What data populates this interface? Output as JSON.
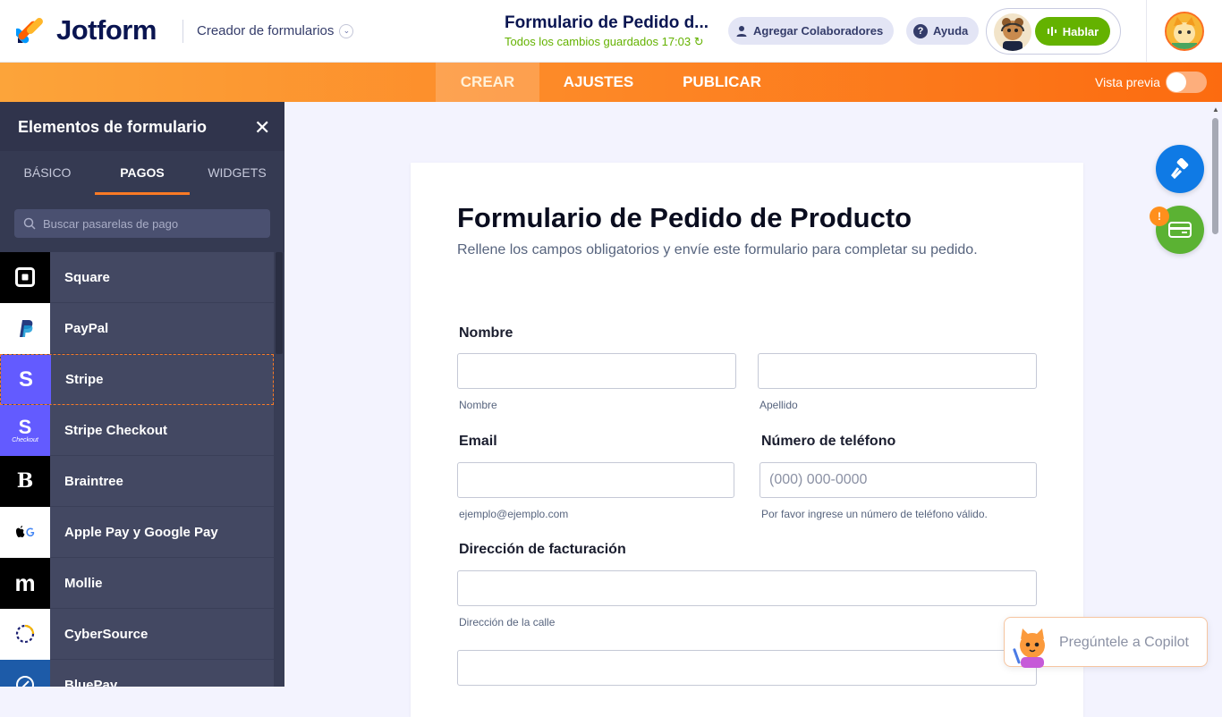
{
  "header": {
    "logo_text": "Jotform",
    "builder_label": "Creador de formularios",
    "form_title": "Formulario de Pedido d...",
    "saved_status": "Todos los cambios guardados 17:03",
    "collab_label": "Agregar Colaboradores",
    "help_label": "Ayuda",
    "talk_label": "Habla​r"
  },
  "nav": {
    "tabs": [
      "CREAR",
      "AJUSTES",
      "PUBLICAR"
    ],
    "active": "CREAR",
    "preview_label": "Vista previa",
    "preview_on": false
  },
  "sidebar": {
    "title": "Elementos de formulario",
    "tabs": [
      "BÁSICO",
      "PAGOS",
      "WIDGETS"
    ],
    "active_tab": "PAGOS",
    "search_placeholder": "Buscar pasarelas de pago",
    "items": [
      {
        "label": "Square",
        "icon": "square-logo-icon"
      },
      {
        "label": "PayPal",
        "icon": "paypal-logo-icon"
      },
      {
        "label": "Stripe",
        "icon": "stripe-logo-icon",
        "selected": true
      },
      {
        "label": "Stripe Checkout",
        "icon": "stripe-checkout-logo-icon",
        "icon_caption": "Checkout"
      },
      {
        "label": "Braintree",
        "icon": "braintree-logo-icon"
      },
      {
        "label": "Apple Pay y Google Pay",
        "icon": "apple-google-pay-logo-icon"
      },
      {
        "label": "Mollie",
        "icon": "mollie-logo-icon"
      },
      {
        "label": "CyberSource",
        "icon": "cybersource-logo-icon"
      },
      {
        "label": "BluePay",
        "icon": "bluepay-logo-icon"
      }
    ]
  },
  "form": {
    "title": "Formulario de Pedido de Producto",
    "subtitle": "Rellene los campos obligatorios y envíe este formulario para completar su pedido.",
    "name_label": "Nombre",
    "first_name_hint": "Nombre",
    "last_name_hint": "Apellido",
    "email_label": "Email",
    "email_hint": "ejemplo@ejemplo.com",
    "phone_label": "Número de teléfono",
    "phone_placeholder": "(000) 000-0000",
    "phone_hint": "Por favor ingrese un número de teléfono válido.",
    "address_label": "Dirección de facturación",
    "street_hint": "Dirección de la calle"
  },
  "floating": {
    "badge": "!",
    "copilot_label": "Pregúntele a Copilot"
  },
  "colors": {
    "brand_navy": "#0a1551",
    "orange": "#fc6b10",
    "green": "#64b200",
    "blue": "#0f7ae5",
    "sidebar_bg": "#434862"
  }
}
